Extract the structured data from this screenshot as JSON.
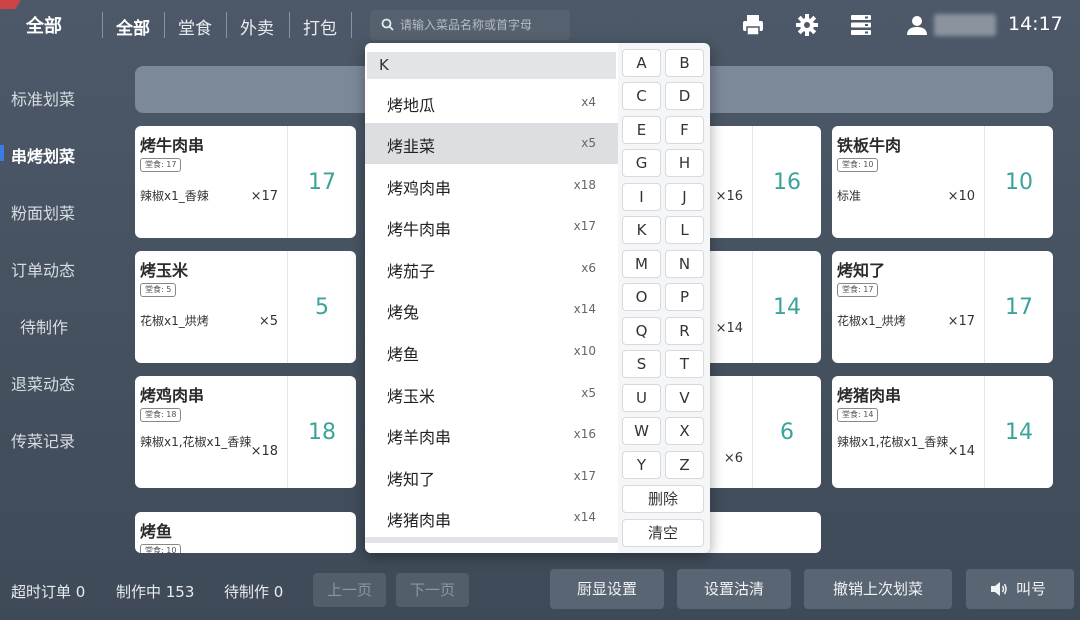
{
  "header": {
    "title": "全部",
    "tabs": [
      "全部",
      "堂食",
      "外卖",
      "打包"
    ],
    "search_placeholder": "请输入菜品名称或首字母",
    "time": "14:17"
  },
  "sidebar": {
    "items": [
      "标准划菜",
      "串烤划菜",
      "粉面划菜",
      "订单动态",
      "待制作",
      "退菜动态",
      "传菜记录"
    ]
  },
  "cards": [
    {
      "name": "烤牛肉串",
      "badge": "堂食: 17",
      "detail": "辣椒x1_香辣",
      "mult": "×17",
      "count": "17"
    },
    {
      "name": "烤玉米",
      "badge": "堂食: 5",
      "detail": "花椒x1_烘烤",
      "mult": "×5",
      "count": "5"
    },
    {
      "name": "烤鸡肉串",
      "badge": "堂食: 18",
      "detail": "辣椒x1,花椒x1_香辣",
      "mult": "×18",
      "count": "18"
    },
    {
      "name": "烤鱼",
      "badge": "堂食: 10"
    },
    {
      "name": "铁板牛肉",
      "badge": "堂食: 10",
      "detail": "标准",
      "mult": "×10",
      "count": "10"
    },
    {
      "name": "烤知了",
      "badge": "堂食: 17",
      "detail": "花椒x1_烘烤",
      "mult": "×17",
      "count": "17"
    },
    {
      "name": "烤猪肉串",
      "badge": "堂食: 14",
      "detail": "辣椒x1,花椒x1_香辣",
      "mult": "×14",
      "count": "14"
    }
  ],
  "hidden_cards": [
    {
      "mult": "×16",
      "count": "16"
    },
    {
      "mult": "×14",
      "count": "14"
    },
    {
      "mult": "×6",
      "count": "6"
    }
  ],
  "dropdown": {
    "letter": "K",
    "items": [
      {
        "name": "烤地瓜",
        "count": "x4"
      },
      {
        "name": "烤韭菜",
        "count": "x5"
      },
      {
        "name": "烤鸡肉串",
        "count": "x18"
      },
      {
        "name": "烤牛肉串",
        "count": "x17"
      },
      {
        "name": "烤茄子",
        "count": "x6"
      },
      {
        "name": "烤兔",
        "count": "x14"
      },
      {
        "name": "烤鱼",
        "count": "x10"
      },
      {
        "name": "烤玉米",
        "count": "x5"
      },
      {
        "name": "烤羊肉串",
        "count": "x16"
      },
      {
        "name": "烤知了",
        "count": "x17"
      },
      {
        "name": "烤猪肉串",
        "count": "x14"
      }
    ],
    "keys": [
      "A",
      "B",
      "C",
      "D",
      "E",
      "F",
      "G",
      "H",
      "I",
      "J",
      "K",
      "L",
      "M",
      "N",
      "O",
      "P",
      "Q",
      "R",
      "S",
      "T",
      "U",
      "V",
      "W",
      "X",
      "Y",
      "Z"
    ],
    "delete_label": "删除",
    "clear_label": "清空"
  },
  "footer": {
    "overdue": "超时订单 0",
    "in_progress": "制作中 153",
    "pending": "待制作 0",
    "prev_page": "上一页",
    "next_page": "下一页",
    "display_settings": "厨显设置",
    "clear_settings": "设置沽清",
    "undo_label": "撤销上次划菜",
    "call_label": "叫号"
  }
}
